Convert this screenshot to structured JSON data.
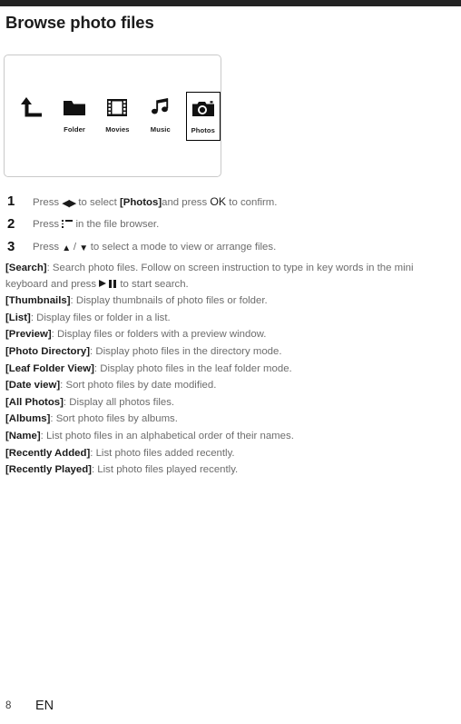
{
  "page": {
    "title": "Browse photo files"
  },
  "screen_panel": {
    "icons": [
      {
        "name": "back-up-arrow-icon",
        "label": ""
      },
      {
        "name": "folder-icon",
        "label": "Folder"
      },
      {
        "name": "movies-filmstrip-icon",
        "label": "Movies"
      },
      {
        "name": "music-note-icon",
        "label": "Music"
      },
      {
        "name": "photos-camera-icon",
        "label": "Photos",
        "selected": true
      }
    ]
  },
  "steps": [
    {
      "number": "1",
      "prefix": "Press ",
      "icon": "left-right-arrows",
      "mid": " to select ",
      "bold1": "[Photos]",
      "mid2": "and press ",
      "bold2": "OK",
      "suffix": " to confirm."
    },
    {
      "number": "2",
      "prefix": "Press ",
      "icon": "list-menu",
      "suffix": " in the file browser."
    },
    {
      "number": "3",
      "prefix": "Press ",
      "icon": "up-down-arrows",
      "suffix": " to select a mode to view or arrange files."
    }
  ],
  "step_glyphs": {
    "left_arrow": "◀",
    "right_arrow": "▶",
    "up_arrow": "▲",
    "down_arrow": "▼",
    "slash": " / "
  },
  "modes": [
    {
      "term": "[Search]",
      "desc_before": ": Search photo files. Follow on screen instruction to type in key words in the mini keyboard and press ",
      "icon": "play-pause",
      "desc_after": " to start search."
    },
    {
      "term": "[Thumbnails]",
      "desc": ": Display thumbnails of photo files or folder."
    },
    {
      "term": "[List]",
      "desc": ": Display files or folder in a list."
    },
    {
      "term": "[Preview]",
      "desc": ": Display files or folders with a preview window."
    },
    {
      "term": "[Photo Directory]",
      "desc": ": Display photo files in the directory mode."
    },
    {
      "term": "[Leaf Folder View]",
      "desc": ": Display photo files in the leaf folder mode."
    },
    {
      "term": "[Date view]",
      "desc": ": Sort photo files by date modified."
    },
    {
      "term": "[All Photos]",
      "desc": ": Display all photos files."
    },
    {
      "term": "[Albums]",
      "desc": ": Sort photo files by albums."
    },
    {
      "term": "[Name]",
      "desc": ": List photo files in an alphabetical order of their names."
    },
    {
      "term": "[Recently Added]",
      "desc": ": List photo files added recently."
    },
    {
      "term": "[Recently Played]",
      "desc": ": List photo files played recently."
    }
  ],
  "footer": {
    "page_number": "8",
    "language": "EN"
  },
  "colors": {
    "top_bar": "#232323",
    "body_text": "#6d6d6d",
    "emphasis_text": "#1b1b1b",
    "panel_border": "#c9c9c9"
  }
}
